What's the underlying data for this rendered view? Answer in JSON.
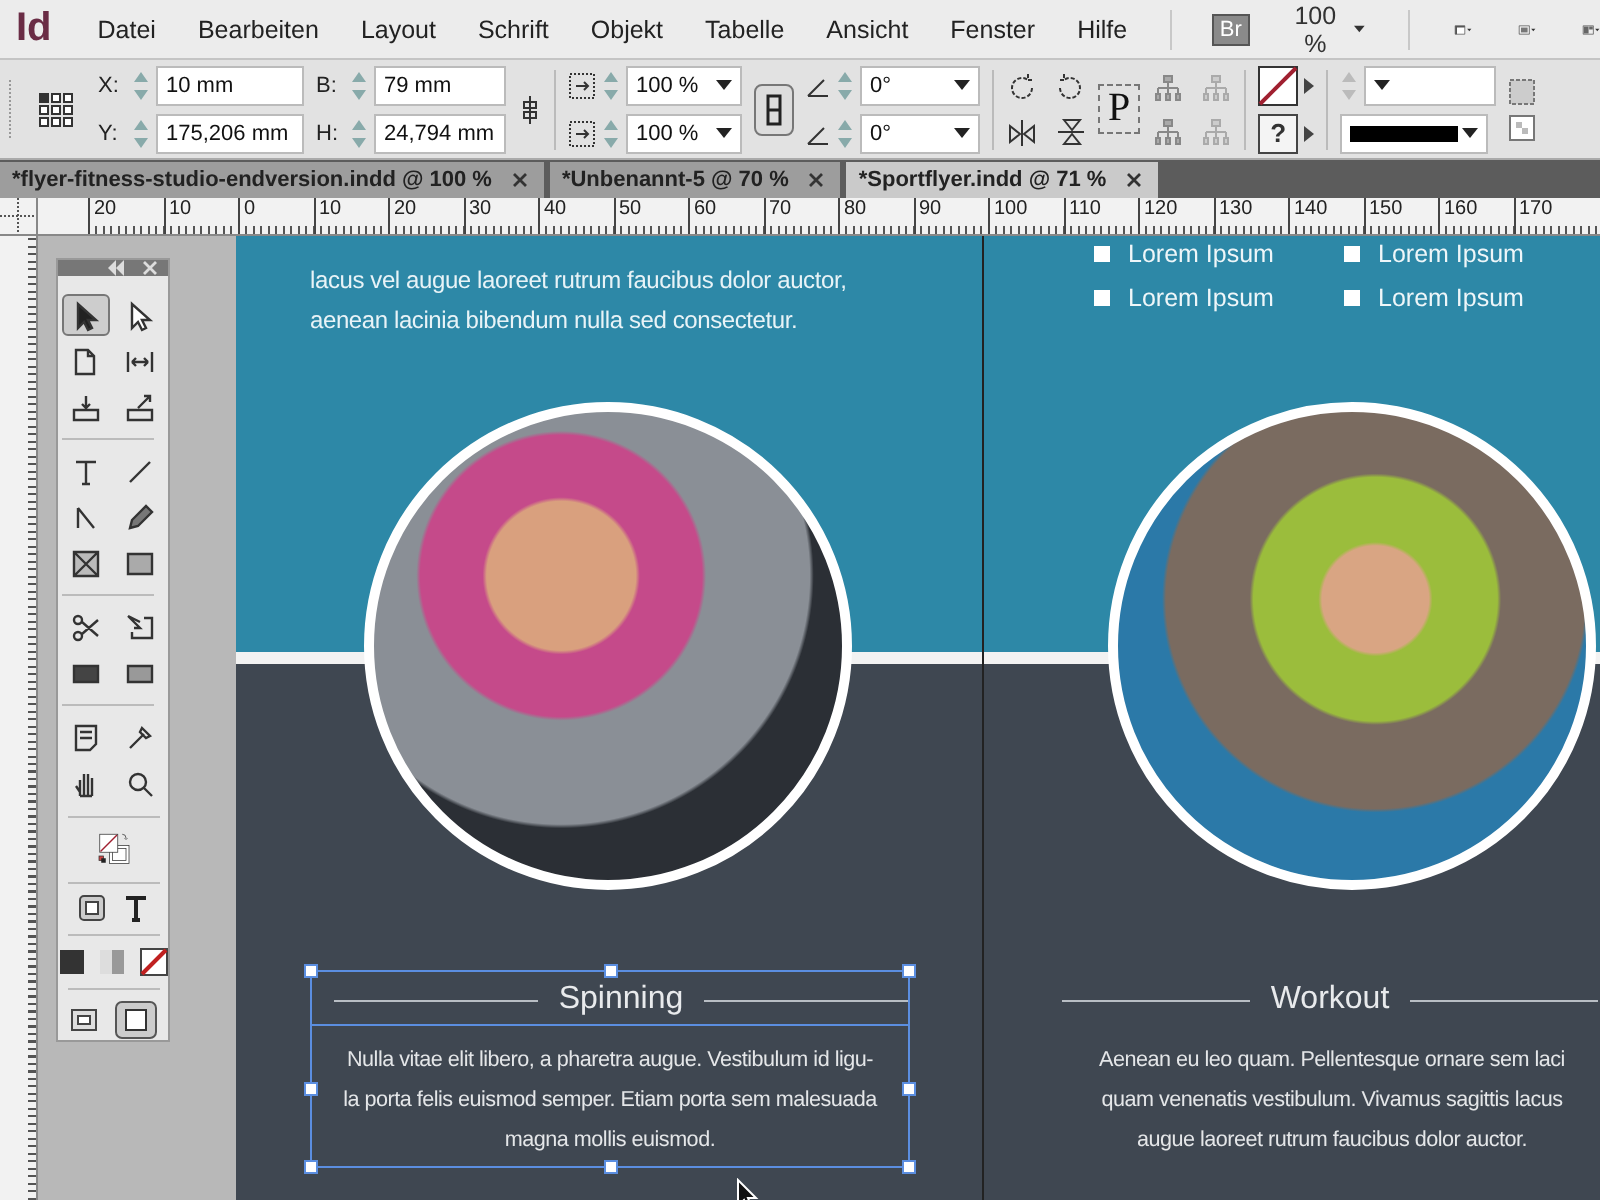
{
  "app": {
    "logo": "Id",
    "menu": [
      "Datei",
      "Bearbeiten",
      "Layout",
      "Schrift",
      "Objekt",
      "Tabelle",
      "Ansicht",
      "Fenster",
      "Hilfe"
    ],
    "bridge": "Br",
    "zoom": "100 %"
  },
  "control_panel": {
    "position": [
      {
        "label": "X:",
        "value": "10 mm"
      },
      {
        "label": "Y:",
        "value": "175,206 mm"
      }
    ],
    "size": [
      {
        "label": "B:",
        "value": "79 mm"
      },
      {
        "label": "H:",
        "value": "24,794 mm"
      }
    ],
    "scale": [
      "100 %",
      "100 %"
    ],
    "angles": [
      "0°",
      "0°"
    ],
    "frame_label": "P",
    "stroke_unknown": "?"
  },
  "tabs": [
    {
      "label": "*flyer-fitness-studio-endversion.indd @ 100 %",
      "selected": false
    },
    {
      "label": "*Unbenannt-5 @ 70 %",
      "selected": false
    },
    {
      "label": "*Sportflyer.indd @ 71 %",
      "selected": true
    }
  ],
  "ruler": {
    "labels": [
      "20",
      "10",
      "0",
      "10",
      "20",
      "30",
      "40",
      "50",
      "60",
      "70",
      "80",
      "90",
      "100",
      "110",
      "120",
      "130",
      "140",
      "150",
      "160",
      "170"
    ]
  },
  "toolbox": {
    "tools": [
      {
        "kind": "selection",
        "selected": true
      },
      {
        "kind": "direct_selection",
        "selected": false
      },
      {
        "kind": "page",
        "selected": false
      },
      {
        "kind": "gap",
        "selected": false
      },
      {
        "kind": "collector",
        "selected": false
      },
      {
        "kind": "placer",
        "selected": false
      },
      {
        "kind": "type",
        "selected": false
      },
      {
        "kind": "line",
        "selected": false
      },
      {
        "kind": "pen",
        "selected": false
      },
      {
        "kind": "pencil",
        "selected": false
      },
      {
        "kind": "frame",
        "selected": false
      },
      {
        "kind": "rectangle",
        "selected": false
      },
      {
        "kind": "scissors",
        "selected": false
      },
      {
        "kind": "transform",
        "selected": false
      },
      {
        "kind": "gradient",
        "selected": false
      },
      {
        "kind": "feather",
        "selected": false
      },
      {
        "kind": "note",
        "selected": false
      },
      {
        "kind": "eyedropper",
        "selected": false
      },
      {
        "kind": "hand",
        "selected": false
      },
      {
        "kind": "zoom",
        "selected": false
      }
    ]
  },
  "page": {
    "sections": [
      {
        "intro_lines": [
          "lacus vel augue laoreet rutrum faucibus dolor auctor,",
          "aenean lacinia bibendum nulla sed consectetur."
        ],
        "heading": "Spinning",
        "selected": true,
        "body_lines": [
          "Nulla vitae elit libero, a pharetra augue. Vestibulum id ligu-",
          "la porta felis euismod semper. Etiam porta sem malesuada",
          "magna mollis euismod."
        ]
      },
      {
        "bullets": [
          "Lorem Ipsum",
          "Lorem Ipsum",
          "Lorem Ipsum",
          "Lorem Ipsum"
        ],
        "heading": "Workout",
        "selected": false,
        "body_lines": [
          "Aenean eu leo quam. Pellentesque ornare sem laci",
          "quam venenatis vestibulum. Vivamus sagittis lacus",
          "augue laoreet rutrum faucibus dolor auctor."
        ]
      }
    ]
  }
}
